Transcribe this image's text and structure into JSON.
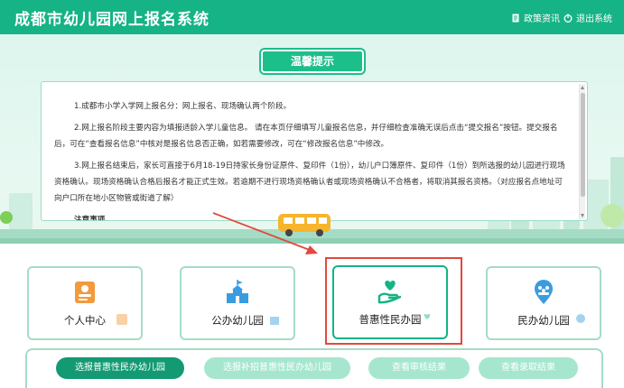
{
  "header": {
    "title": "成都市幼儿园网上报名系统",
    "policy_label": "政策资讯",
    "logout_label": "退出系统"
  },
  "notice": {
    "badge": "温馨提示",
    "paragraphs": [
      "1.成都市小学入学网上报名分：网上报名、现场确认两个阶段。",
      "2.网上报名阶段主要内容为填报适龄入学儿童信息。 请在本页仔细填写儿童报名信息，并仔细检查准确无误后点击“提交报名”按钮。提交报名后，可在“查看报名信息”中核对是报名信息否正确，如若需要修改，可在“修改报名信息”中修改。",
      "3.网上报名结束后，家长可直接于6月18-19日持家长身份证原件、复印件（1份），幼儿户口簿原件、复印件（1份）到所选报的幼儿园进行现场资格确认。现场资格确认合格后报名才能正式生效。若逾期不进行现场资格确认者或现场资格确认不合格者，将取消其报名资格。（对应报名点地址可向户口所在地小区物管或街道了解）",
      "注意事项"
    ]
  },
  "cards": [
    {
      "label": "个人中心",
      "icon": "person-card-icon"
    },
    {
      "label": "公办幼儿园",
      "icon": "school-building-icon"
    },
    {
      "label": "普惠性民办园",
      "icon": "heart-hand-icon"
    },
    {
      "label": "民办幼儿园",
      "icon": "location-people-icon"
    }
  ],
  "actions": [
    {
      "label": "选报普惠性民办幼儿园"
    },
    {
      "label": "选报补招普惠性民办幼儿园"
    },
    {
      "label": "查看审核结果"
    },
    {
      "label": "查看录取结果"
    }
  ],
  "colors": {
    "brand": "#15b385",
    "accent_dark": "#139a72",
    "accent_light": "#a6dcc5",
    "highlight": "#e2483d",
    "orange": "#f39a3d",
    "blue": "#3a9ce0"
  }
}
